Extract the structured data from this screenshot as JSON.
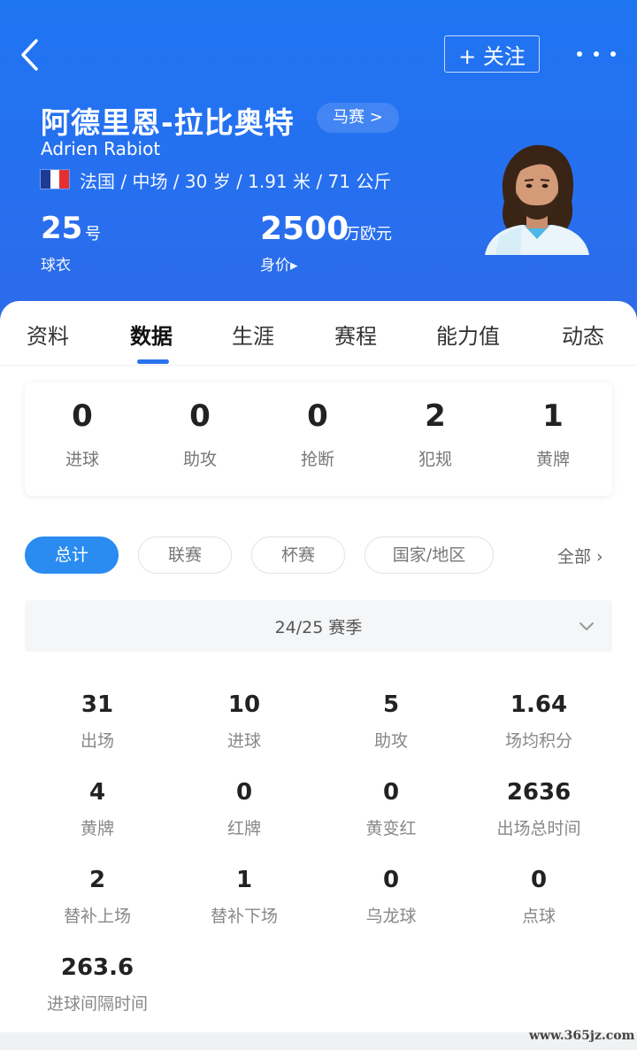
{
  "header": {
    "follow_label": "+ 关注",
    "name_cn": "阿德里恩-拉比奥特",
    "club_label": "马赛 >",
    "name_en": "Adrien Rabiot",
    "flag_colors": [
      "#1f3a93",
      "#ffffff",
      "#e63030"
    ],
    "info_line": "法国 / 中场 / 30 岁 / 1.91 米 / 71 公斤",
    "jersey_number": "25",
    "jersey_unit": "号",
    "jersey_label": "球衣",
    "market_value": "2500",
    "market_value_unit": "万欧元",
    "market_value_label": "身价▸"
  },
  "tabs": [
    {
      "label": "资料"
    },
    {
      "label": "数据"
    },
    {
      "label": "生涯"
    },
    {
      "label": "赛程"
    },
    {
      "label": "能力值"
    },
    {
      "label": "动态"
    }
  ],
  "active_tab": "数据",
  "summary": [
    {
      "value": "0",
      "label": "进球"
    },
    {
      "value": "0",
      "label": "助攻"
    },
    {
      "value": "0",
      "label": "抢断"
    },
    {
      "value": "2",
      "label": "犯规"
    },
    {
      "value": "1",
      "label": "黄牌"
    }
  ],
  "filters": {
    "chips": [
      {
        "label": "总计"
      },
      {
        "label": "联赛"
      },
      {
        "label": "杯赛"
      },
      {
        "label": "国家/地区"
      }
    ],
    "active": "总计",
    "all_label": "全部 ›"
  },
  "season": {
    "label": "24/25 赛季"
  },
  "stats": [
    {
      "value": "31",
      "label": "出场"
    },
    {
      "value": "10",
      "label": "进球"
    },
    {
      "value": "5",
      "label": "助攻"
    },
    {
      "value": "1.64",
      "label": "场均积分"
    },
    {
      "value": "4",
      "label": "黄牌"
    },
    {
      "value": "0",
      "label": "红牌"
    },
    {
      "value": "0",
      "label": "黄变红"
    },
    {
      "value": "2636",
      "label": "出场总时间"
    },
    {
      "value": "2",
      "label": "替补上场"
    },
    {
      "value": "1",
      "label": "替补下场"
    },
    {
      "value": "0",
      "label": "乌龙球"
    },
    {
      "value": "0",
      "label": "点球"
    },
    {
      "value": "263.6",
      "label": "进球间隔时间"
    }
  ],
  "watermark": "www.365jz.com",
  "colors": {
    "header_blue": "#2670f0",
    "accent_blue": "#2a8cf0"
  }
}
